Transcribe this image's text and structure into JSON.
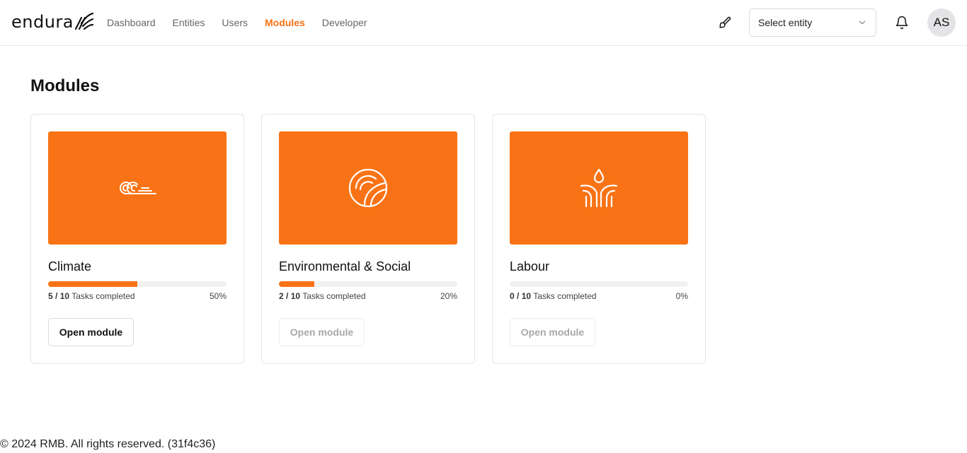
{
  "header": {
    "logo_text": "endura",
    "nav": [
      {
        "label": "Dashboard",
        "active": false
      },
      {
        "label": "Entities",
        "active": false
      },
      {
        "label": "Users",
        "active": false
      },
      {
        "label": "Modules",
        "active": true
      },
      {
        "label": "Developer",
        "active": false
      }
    ],
    "entity_select": {
      "label": "Select entity"
    },
    "avatar_initials": "AS"
  },
  "main": {
    "title": "Modules",
    "modules": [
      {
        "name": "Climate",
        "completed": "5",
        "total": "10",
        "tasks_suffix": "Tasks completed",
        "percent_label": "50%",
        "progress": 0.5,
        "button_label": "Open module",
        "enabled": true,
        "icon": "wind-icon"
      },
      {
        "name": "Environmental & Social",
        "completed": "2",
        "total": "10",
        "tasks_suffix": "Tasks completed",
        "percent_label": "20%",
        "progress": 0.2,
        "button_label": "Open module",
        "enabled": false,
        "icon": "leaf-globe-icon"
      },
      {
        "name": "Labour",
        "completed": "0",
        "total": "10",
        "tasks_suffix": "Tasks completed",
        "percent_label": "0%",
        "progress": 0.0,
        "button_label": "Open module",
        "enabled": false,
        "icon": "hands-droplet-icon"
      }
    ]
  },
  "footer": {
    "text": "© 2024 RMB. All rights reserved. (31f4c36)"
  },
  "colors": {
    "accent": "#f97316",
    "banner": "#f97316",
    "border": "#e4e4e7"
  }
}
